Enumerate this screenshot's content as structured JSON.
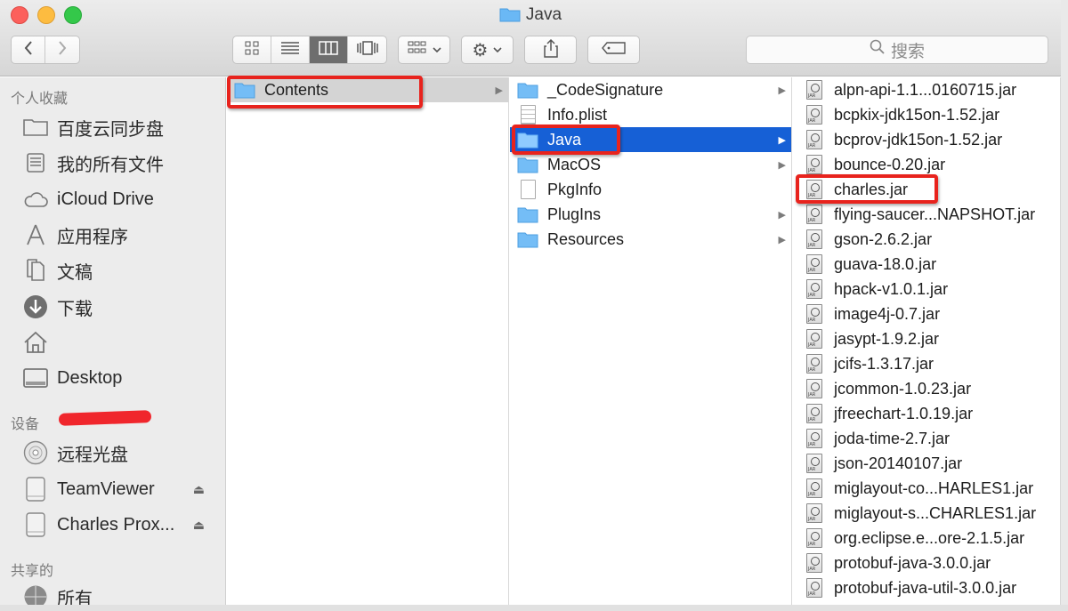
{
  "window": {
    "title": "Java"
  },
  "toolbar": {
    "back_icon": "chevron-left-icon",
    "forward_icon": "chevron-right-icon",
    "view_modes": [
      "icon-view-icon",
      "list-view-icon",
      "column-view-icon",
      "coverflow-view-icon"
    ],
    "active_view": "column-view-icon",
    "search_placeholder": "搜索"
  },
  "sidebar": {
    "favorites_title": "个人收藏",
    "favorites": [
      {
        "label": "百度云同步盘",
        "icon": "folder-icon"
      },
      {
        "label": "我的所有文件",
        "icon": "all-files-icon"
      },
      {
        "label": "iCloud Drive",
        "icon": "cloud-icon"
      },
      {
        "label": "应用程序",
        "icon": "applications-icon"
      },
      {
        "label": "文稿",
        "icon": "documents-icon"
      },
      {
        "label": "下载",
        "icon": "download-icon"
      },
      {
        "label": "",
        "icon": "home-icon"
      },
      {
        "label": "Desktop",
        "icon": "desktop-icon"
      }
    ],
    "devices_title": "设备",
    "devices": [
      {
        "label": "远程光盘",
        "icon": "disc-icon"
      },
      {
        "label": "TeamViewer",
        "icon": "drive-icon",
        "eject": true
      },
      {
        "label": "Charles Prox...",
        "icon": "drive-icon",
        "eject": true
      }
    ],
    "shared_title": "共享的",
    "shared": [
      {
        "label": "所有",
        "icon": "network-icon"
      }
    ]
  },
  "columns": {
    "col1": [
      {
        "label": "Contents",
        "folder": true
      }
    ],
    "col2": [
      {
        "label": "_CodeSignature",
        "folder": true
      },
      {
        "label": "Info.plist",
        "folder": false
      },
      {
        "label": "Java",
        "folder": true
      },
      {
        "label": "MacOS",
        "folder": true
      },
      {
        "label": "PkgInfo",
        "folder": false
      },
      {
        "label": "PlugIns",
        "folder": true
      },
      {
        "label": "Resources",
        "folder": true
      }
    ],
    "col3": [
      "alpn-api-1.1...0160715.jar",
      "bcpkix-jdk15on-1.52.jar",
      "bcprov-jdk15on-1.52.jar",
      "bounce-0.20.jar",
      "charles.jar",
      "flying-saucer...NAPSHOT.jar",
      "gson-2.6.2.jar",
      "guava-18.0.jar",
      "hpack-v1.0.1.jar",
      "image4j-0.7.jar",
      "jasypt-1.9.2.jar",
      "jcifs-1.3.17.jar",
      "jcommon-1.0.23.jar",
      "jfreechart-1.0.19.jar",
      "joda-time-2.7.jar",
      "json-20140107.jar",
      "miglayout-co...HARLES1.jar",
      "miglayout-s...CHARLES1.jar",
      "org.eclipse.e...ore-2.1.5.jar",
      "protobuf-java-3.0.0.jar",
      "protobuf-java-util-3.0.0.jar"
    ]
  }
}
